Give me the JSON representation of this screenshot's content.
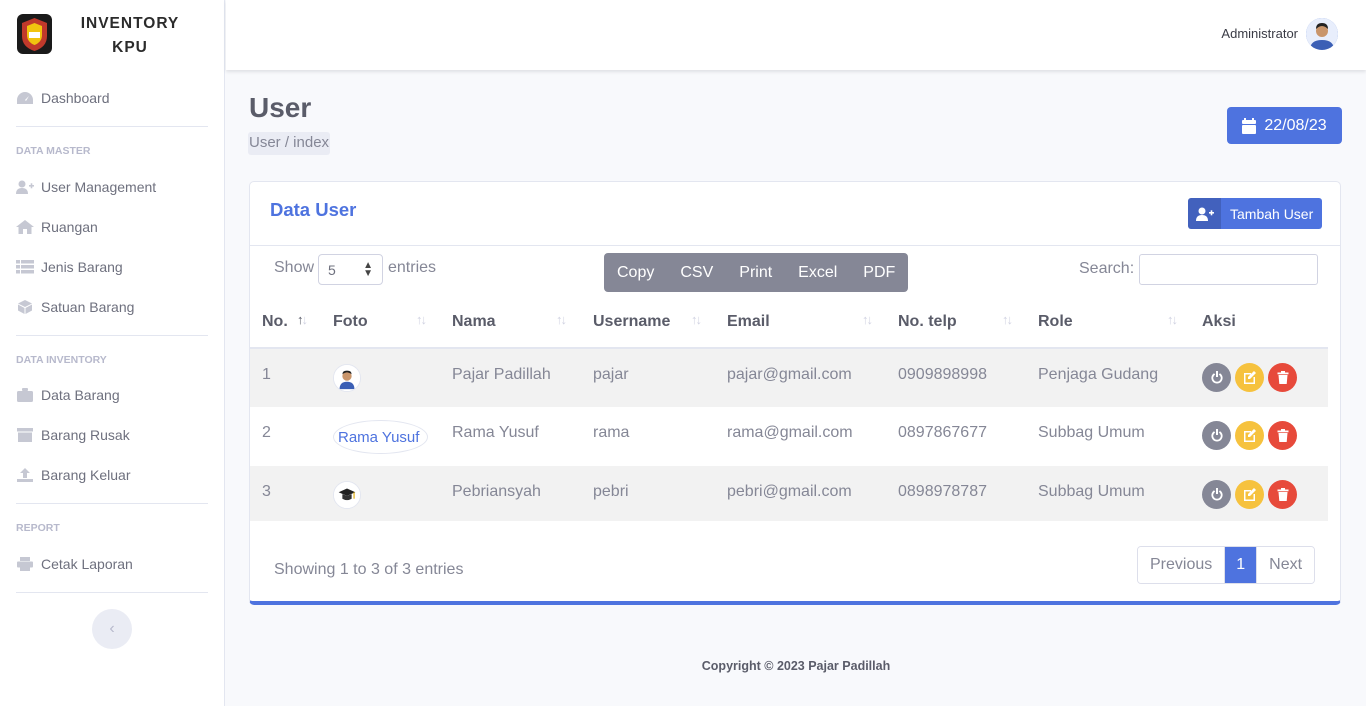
{
  "app": {
    "title_line1": "INVENTORY",
    "title_line2": "KPU"
  },
  "sidebar": {
    "dashboard": "Dashboard",
    "section_master": "DATA MASTER",
    "user_management": "User Management",
    "ruangan": "Ruangan",
    "jenis_barang": "Jenis Barang",
    "satuan_barang": "Satuan Barang",
    "section_inventory": "DATA INVENTORY",
    "data_barang": "Data Barang",
    "barang_rusak": "Barang Rusak",
    "barang_keluar": "Barang Keluar",
    "section_report": "REPORT",
    "cetak_laporan": "Cetak Laporan",
    "toggle_glyph": "‹"
  },
  "topbar": {
    "user_name": "Administrator"
  },
  "page": {
    "title": "User",
    "breadcrumb": "User / index",
    "date": "22/08/23"
  },
  "card": {
    "title": "Data User",
    "add_button": "Tambah User",
    "show_label": "Show",
    "length_value": "5",
    "entries_label": "entries",
    "export_buttons": [
      "Copy",
      "CSV",
      "Print",
      "Excel",
      "PDF"
    ],
    "search_label": "Search:",
    "search_value": ""
  },
  "table": {
    "columns": [
      "No.",
      "Foto",
      "Nama",
      "Username",
      "Email",
      "No. telp",
      "Role",
      "Aksi"
    ],
    "rows": [
      {
        "no": "1",
        "foto_alt": "",
        "nama": "Pajar Padillah",
        "username": "pajar",
        "email": "pajar@gmail.com",
        "telp": "0909898998",
        "role": "Penjaga Gudang"
      },
      {
        "no": "2",
        "foto_alt": "Rama Yusuf",
        "nama": "Rama Yusuf",
        "username": "rama",
        "email": "rama@gmail.com",
        "telp": "0897867677",
        "role": "Subbag Umum"
      },
      {
        "no": "3",
        "foto_alt": "",
        "nama": "Pebriansyah",
        "username": "pebri",
        "email": "pebri@gmail.com",
        "telp": "0898978787",
        "role": "Subbag Umum"
      }
    ]
  },
  "pagination": {
    "info": "Showing 1 to 3 of 3 entries",
    "previous": "Previous",
    "current": "1",
    "next": "Next"
  },
  "footer": {
    "copyright": "Copyright © 2023 Pajar Padillah"
  },
  "colors": {
    "primary": "#4e73df",
    "secondary": "#858796",
    "warning": "#f6c23e",
    "danger": "#e74a3b"
  }
}
